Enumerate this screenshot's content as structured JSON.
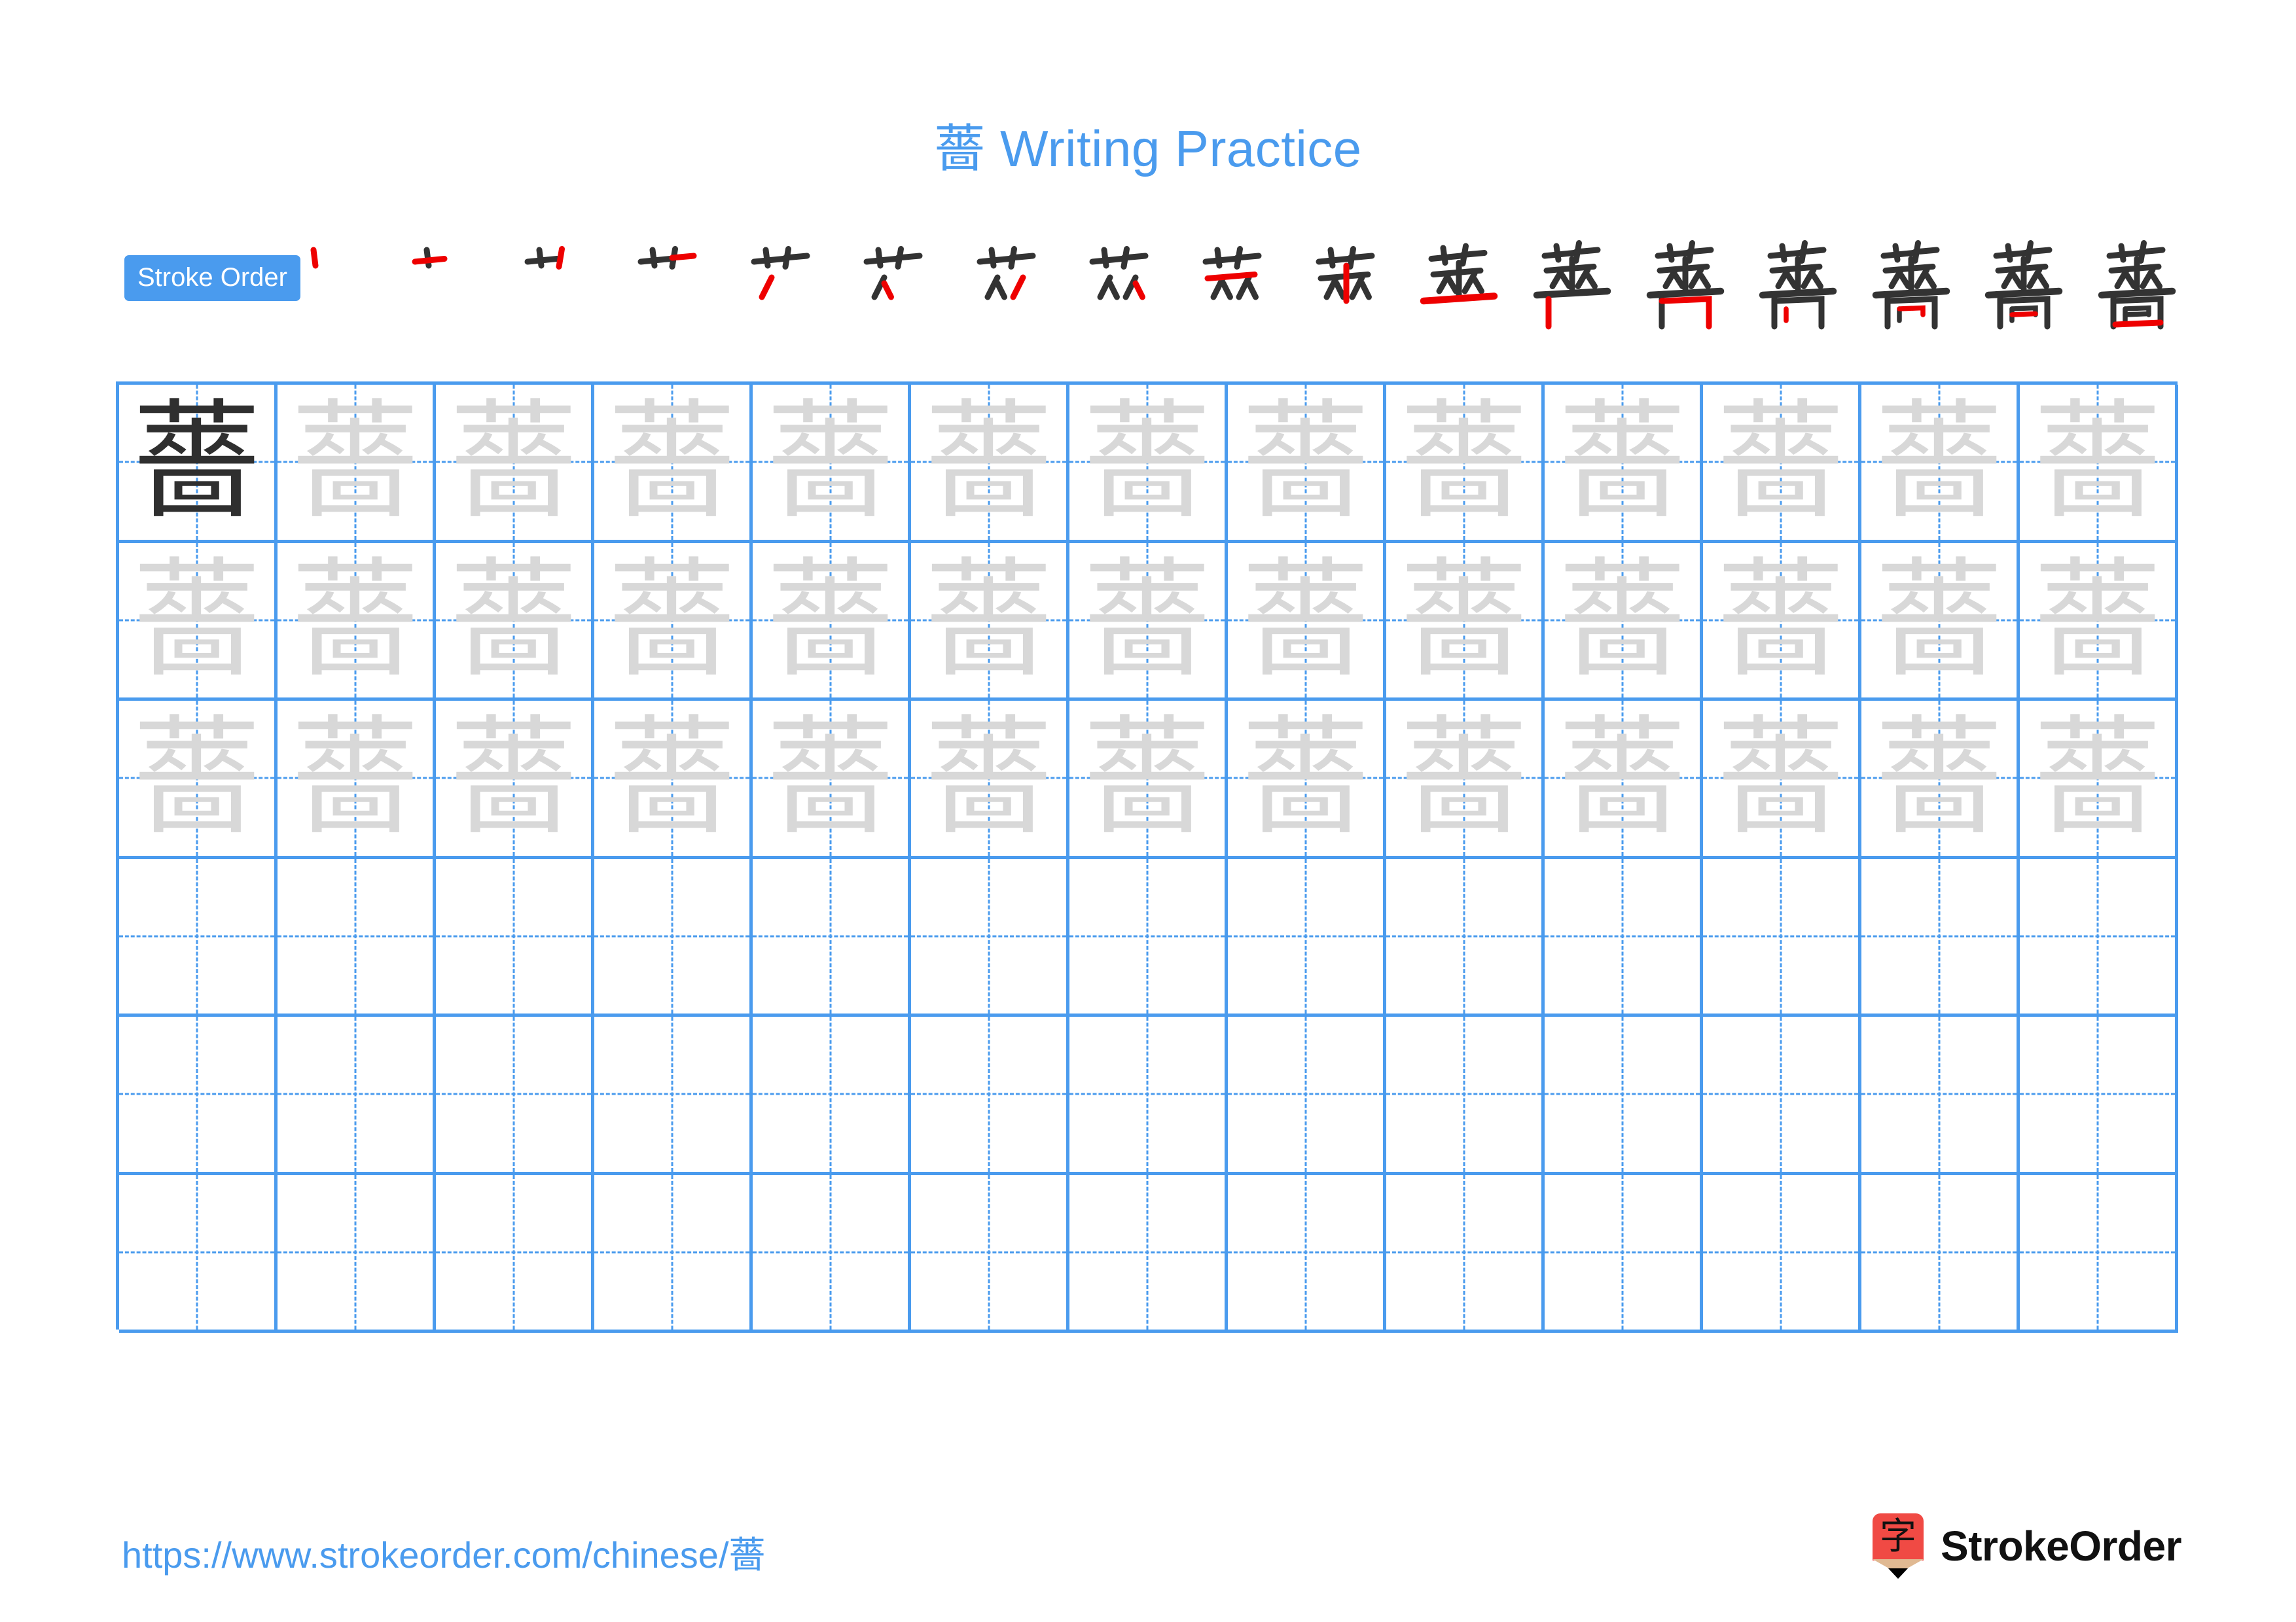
{
  "character": "薔",
  "title": {
    "character": "薔",
    "text": " Writing Practice",
    "full": "薔 Writing Practice",
    "color": "#4a9bee"
  },
  "stroke_order": {
    "label": "Stroke Order",
    "label_bg": "#4a9bee",
    "label_color": "#ffffff",
    "total_steps": 17,
    "existing_stroke_color": "#333333",
    "new_stroke_color": "#ee0000",
    "steps": [
      {
        "index": 1,
        "strokes_shown": 1,
        "new_stroke": "dot-left-top"
      },
      {
        "index": 2,
        "strokes_shown": 2,
        "new_stroke": "horizontal"
      },
      {
        "index": 3,
        "strokes_shown": 3,
        "new_stroke": "vertical-right"
      },
      {
        "index": 4,
        "strokes_shown": 4,
        "new_stroke": "short-horizontal-right"
      },
      {
        "index": 5,
        "strokes_shown": 5,
        "new_stroke": "left-downstroke"
      },
      {
        "index": 6,
        "strokes_shown": 6,
        "new_stroke": "left-dot"
      },
      {
        "index": 7,
        "strokes_shown": 7,
        "new_stroke": "right-downstroke"
      },
      {
        "index": 8,
        "strokes_shown": 8,
        "new_stroke": "right-dot"
      },
      {
        "index": 9,
        "strokes_shown": 9,
        "new_stroke": "middle-horizontal"
      },
      {
        "index": 10,
        "strokes_shown": 10,
        "new_stroke": "center-vertical"
      },
      {
        "index": 11,
        "strokes_shown": 11,
        "new_stroke": "long-horizontal"
      },
      {
        "index": 12,
        "strokes_shown": 12,
        "new_stroke": "box-left-vertical"
      },
      {
        "index": 13,
        "strokes_shown": 13,
        "new_stroke": "box-top-right-hook"
      },
      {
        "index": 14,
        "strokes_shown": 14,
        "new_stroke": "inner-left-vertical"
      },
      {
        "index": 15,
        "strokes_shown": 15,
        "new_stroke": "inner-top-right"
      },
      {
        "index": 16,
        "strokes_shown": 16,
        "new_stroke": "inner-middle-horizontal"
      },
      {
        "index": 17,
        "strokes_shown": 17,
        "new_stroke": "box-bottom-horizontal"
      }
    ]
  },
  "practice_grid": {
    "columns": 13,
    "rows": 6,
    "filled_rows": 3,
    "empty_rows": 3,
    "model_cell": {
      "row": 1,
      "column": 1,
      "color": "#2f2f2f"
    },
    "trace_color": "#d8d8d8",
    "grid_line_color": "#4a9bee",
    "guide_line_color": "#4a9bee",
    "rows_data": [
      {
        "row": 1,
        "cells": [
          "薔",
          "薔",
          "薔",
          "薔",
          "薔",
          "薔",
          "薔",
          "薔",
          "薔",
          "薔",
          "薔",
          "薔",
          "薔"
        ]
      },
      {
        "row": 2,
        "cells": [
          "薔",
          "薔",
          "薔",
          "薔",
          "薔",
          "薔",
          "薔",
          "薔",
          "薔",
          "薔",
          "薔",
          "薔",
          "薔"
        ]
      },
      {
        "row": 3,
        "cells": [
          "薔",
          "薔",
          "薔",
          "薔",
          "薔",
          "薔",
          "薔",
          "薔",
          "薔",
          "薔",
          "薔",
          "薔",
          "薔"
        ]
      },
      {
        "row": 4,
        "cells": [
          "",
          "",
          "",
          "",
          "",
          "",
          "",
          "",
          "",
          "",
          "",
          "",
          ""
        ]
      },
      {
        "row": 5,
        "cells": [
          "",
          "",
          "",
          "",
          "",
          "",
          "",
          "",
          "",
          "",
          "",
          "",
          ""
        ]
      },
      {
        "row": 6,
        "cells": [
          "",
          "",
          "",
          "",
          "",
          "",
          "",
          "",
          "",
          "",
          "",
          "",
          ""
        ]
      }
    ]
  },
  "footer": {
    "url_prefix": "https://www.strokeorder.com/chinese/",
    "url_character": "薔",
    "url_full": "https://www.strokeorder.com/chinese/薔",
    "url_color": "#4a9bee",
    "brand_name": "StrokeOrder",
    "brand_icon_character": "字",
    "brand_icon_color": "#f04a44"
  }
}
